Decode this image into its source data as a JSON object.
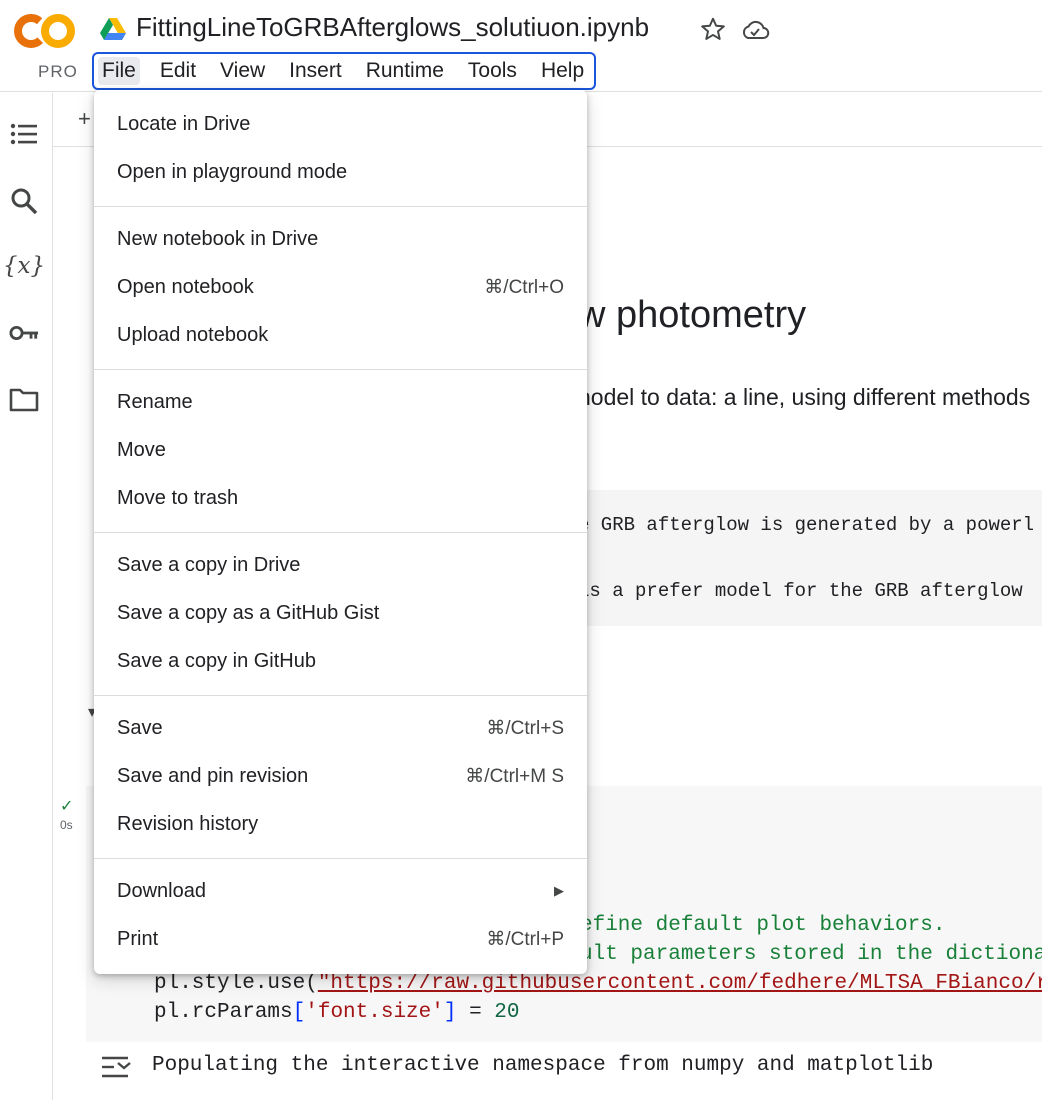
{
  "header": {
    "logo_text": "CO",
    "plan_badge": "PRO",
    "notebook_title": "FittingLineToGRBAfterglows_solutiuon.ipynb",
    "menus": [
      "File",
      "Edit",
      "View",
      "Insert",
      "Runtime",
      "Tools",
      "Help"
    ],
    "active_menu": "File"
  },
  "rail": {
    "icons": [
      "table-of-contents-icon",
      "search-icon",
      "variables-icon",
      "secrets-key-icon",
      "files-folder-icon"
    ],
    "variables_glyph": "{x}"
  },
  "notebook": {
    "add_cell_glyph": "+",
    "heading_visible": "w photometry",
    "paragraph_visible": "nodel to data: a line, using different methods",
    "text_cell_lines": [
      "e GRB afterglow is generated by a powerl",
      " is a prefer model for the GRB afterglow"
    ],
    "exec_time": "0s",
    "code": {
      "line1_comment": "efine default plot behaviors.",
      "line2_comment": "ult parameters stored in the dictiona",
      "line3_prefix": "pl.style.use(",
      "line3_string": "\"https://raw.githubusercontent.com/fedhere/MLTSA_FBianco/r",
      "line4_prefix": "pl.rcParams",
      "line4_key": "'font.size'",
      "line4_op": " = ",
      "line4_value": "20"
    },
    "output_text": "Populating the interactive namespace from numpy and matplotlib"
  },
  "file_menu": {
    "items": [
      {
        "label": "Locate in Drive",
        "shortcut": ""
      },
      {
        "label": "Open in playground mode",
        "shortcut": ""
      },
      {
        "label": "New notebook in Drive",
        "shortcut": ""
      },
      {
        "label": "Open notebook",
        "shortcut": "⌘/Ctrl+O"
      },
      {
        "label": "Upload notebook",
        "shortcut": ""
      },
      {
        "label": "Rename",
        "shortcut": ""
      },
      {
        "label": "Move",
        "shortcut": ""
      },
      {
        "label": "Move to trash",
        "shortcut": ""
      },
      {
        "label": "Save a copy in Drive",
        "shortcut": ""
      },
      {
        "label": "Save a copy as a GitHub Gist",
        "shortcut": ""
      },
      {
        "label": "Save a copy in GitHub",
        "shortcut": ""
      },
      {
        "label": "Save",
        "shortcut": "⌘/Ctrl+S"
      },
      {
        "label": "Save and pin revision",
        "shortcut": "⌘/Ctrl+M S"
      },
      {
        "label": "Revision history",
        "shortcut": ""
      },
      {
        "label": "Download",
        "shortcut": "",
        "submenu": "▶"
      },
      {
        "label": "Print",
        "shortcut": "⌘/Ctrl+P"
      }
    ]
  },
  "colors": {
    "logo_orange": "#f9ab00",
    "logo_orange_dark": "#e8710a",
    "menubar_focus_border": "#1a56db",
    "comment_green": "#188038",
    "string_red": "#a31515"
  }
}
